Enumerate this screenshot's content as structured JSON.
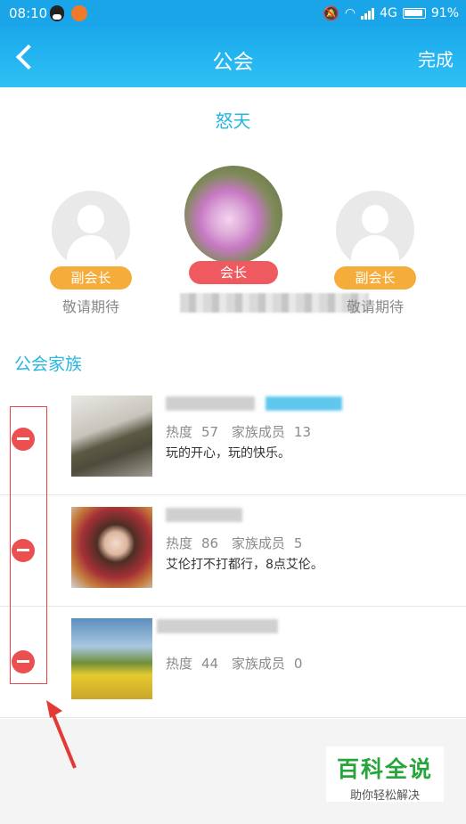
{
  "status_bar": {
    "time": "08:10",
    "network": "4G",
    "battery": "91%"
  },
  "nav": {
    "title": "公会",
    "done_label": "完成"
  },
  "guild": {
    "name": "怒天"
  },
  "members": [
    {
      "role": "副会长",
      "name": "敬请期待"
    },
    {
      "role": "会长",
      "name": ""
    },
    {
      "role": "副会长",
      "name": "敬请期待"
    }
  ],
  "section": {
    "title": "公会家族"
  },
  "families": [
    {
      "heat_label": "热度",
      "heat": "57",
      "members_label": "家族成员",
      "member_count": "13",
      "motto": "玩的开心，玩的快乐。"
    },
    {
      "heat_label": "热度",
      "heat": "86",
      "members_label": "家族成员",
      "member_count": "5",
      "motto": "艾伦打不打都行，8点艾伦。"
    },
    {
      "heat_label": "热度",
      "heat": "44",
      "members_label": "家族成员",
      "member_count": "0",
      "motto": ""
    }
  ],
  "watermark": {
    "brand": "百科全说",
    "slogan": "助你轻松解决"
  },
  "colors": {
    "accent": "#27b5e2",
    "remove": "#ec4f4f",
    "vice_badge": "#f6ac3a",
    "chief_badge": "#ee5a5f"
  }
}
